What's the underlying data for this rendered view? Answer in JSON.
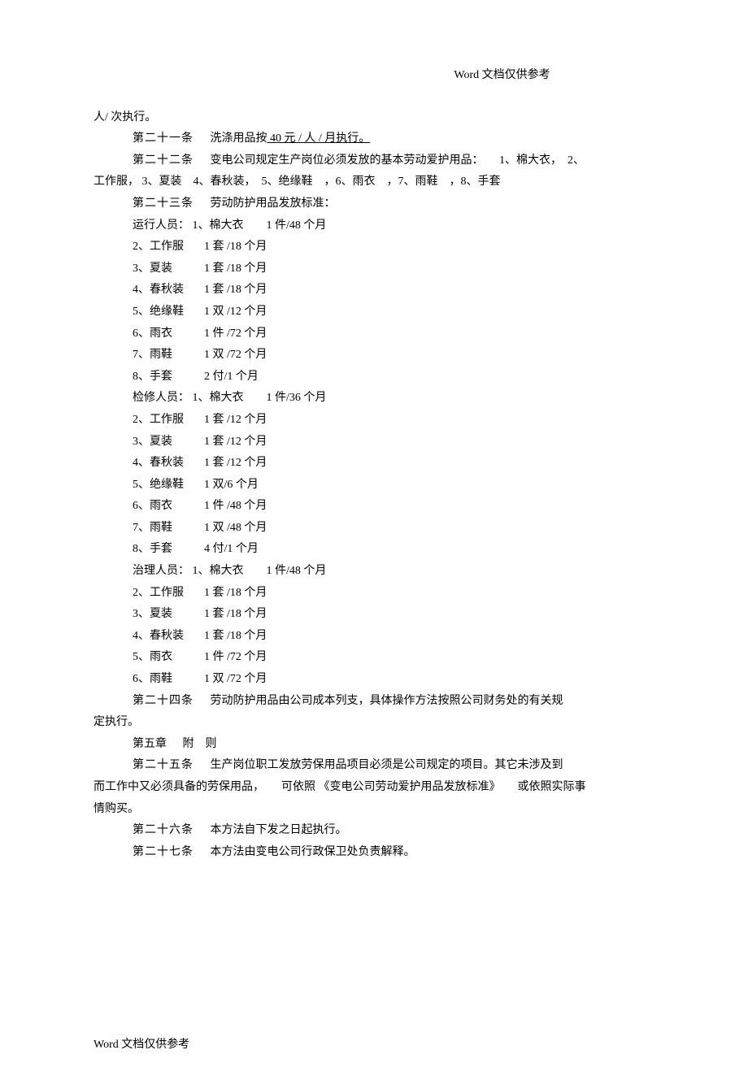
{
  "header": "Word 文档仅供参考",
  "footer": "Word 文档仅供参考",
  "line_prev": "人/ 次执行。",
  "a21": {
    "num": "第二十一条",
    "text_prefix": "洗涤用品按",
    "text_underline": " 40 元 / 人 / 月执行。"
  },
  "a22": {
    "num": "第二十二条",
    "text": "变电公司规定生产岗位必须发放的基本劳动爱护用品：",
    "items_tail": "1、棉大衣，　2、",
    "items_line2": "工作服，  3、夏装　4、春秋装，　5、绝缘鞋　，6、雨衣　，7、雨鞋　，8、手套"
  },
  "a23": {
    "num": "第二十三条",
    "text": "劳动防护用品发放标准："
  },
  "group1": {
    "title": "运行人员： 1、棉大衣　　1 件/48 个月",
    "rows": [
      {
        "n": "2、工作服",
        "q": "1 套 /18 个月"
      },
      {
        "n": "3、夏装",
        "q": "1 套 /18 个月"
      },
      {
        "n": "4、春秋装",
        "q": "1 套 /18 个月"
      },
      {
        "n": "5、绝缘鞋",
        "q": "1 双 /12 个月"
      },
      {
        "n": "6、雨衣",
        "q": "1 件 /72 个月"
      },
      {
        "n": "7、雨鞋",
        "q": "1 双 /72 个月"
      },
      {
        "n": "8、手套",
        "q": "2 付/1 个月"
      }
    ]
  },
  "group2": {
    "title": "检修人员： 1、棉大衣　　1 件/36 个月",
    "rows": [
      {
        "n": "2、工作服",
        "q": "1 套 /12 个月"
      },
      {
        "n": "3、夏装",
        "q": "1 套 /12 个月"
      },
      {
        "n": "4、春秋装",
        "q": "1 套 /12 个月"
      },
      {
        "n": "5、绝缘鞋",
        "q": "1 双/6 个月"
      },
      {
        "n": "6、雨衣",
        "q": "1 件 /48 个月"
      },
      {
        "n": "7、雨鞋",
        "q": "1 双 /48 个月"
      },
      {
        "n": "8、手套",
        "q": "4 付/1 个月"
      }
    ]
  },
  "group3": {
    "title": "治理人员： 1、棉大衣　　1 件/48 个月",
    "rows": [
      {
        "n": "2、工作服",
        "q": "1 套 /18 个月"
      },
      {
        "n": "3、夏装",
        "q": "1 套 /18 个月"
      },
      {
        "n": "4、春秋装",
        "q": "1 套 /18 个月"
      },
      {
        "n": "5、雨衣",
        "q": "1 件 /72 个月"
      },
      {
        "n": "6、雨鞋",
        "q": "1 双 /72 个月"
      }
    ]
  },
  "a24": {
    "num": "第二十四条",
    "text": "劳动防护用品由公司成本列支，具体操作方法按照公司财务处的有关规",
    "cont": "定执行。"
  },
  "a_ch5": {
    "num": "第五章",
    "text": "附　则"
  },
  "a25": {
    "num": "第二十五条",
    "text": "生产岗位职工发放劳保用品项目必须是公司规定的项目。其它未涉及到",
    "cont": "而工作中又必须具备的劳保用品，　　可依照 《变电公司劳动爱护用品发放标准》　　或依照实际事",
    "cont2": "情购买。"
  },
  "a26": {
    "num": "第二十六条",
    "text": "本方法自下发之日起执行。"
  },
  "a27": {
    "num": "第二十七条",
    "text": "本方法由变电公司行政保卫处负责解释。"
  }
}
